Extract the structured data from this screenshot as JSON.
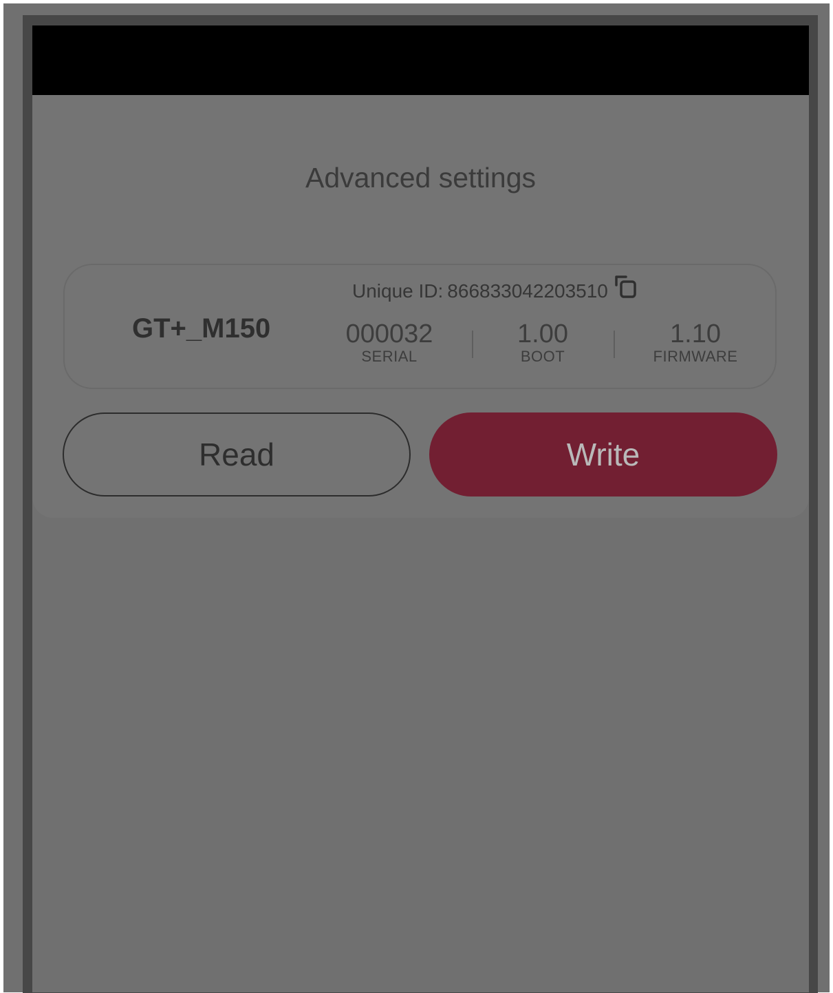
{
  "screen": {
    "title": "Advanced settings"
  },
  "device": {
    "name": "GT+_M150",
    "unique_id_label": "Unique ID:",
    "unique_id_value": "866833042203510",
    "copy_icon": "copy-icon",
    "stats": [
      {
        "value": "000032",
        "label": "SERIAL"
      },
      {
        "value": "1.00",
        "label": "BOOT"
      },
      {
        "value": "1.10",
        "label": "FIRMWARE"
      }
    ]
  },
  "actions": {
    "read_label": "Read",
    "write_label": "Write"
  },
  "colors": {
    "accent": "#721f32",
    "overlay_background": "#707070",
    "status_bar": "#000000"
  }
}
